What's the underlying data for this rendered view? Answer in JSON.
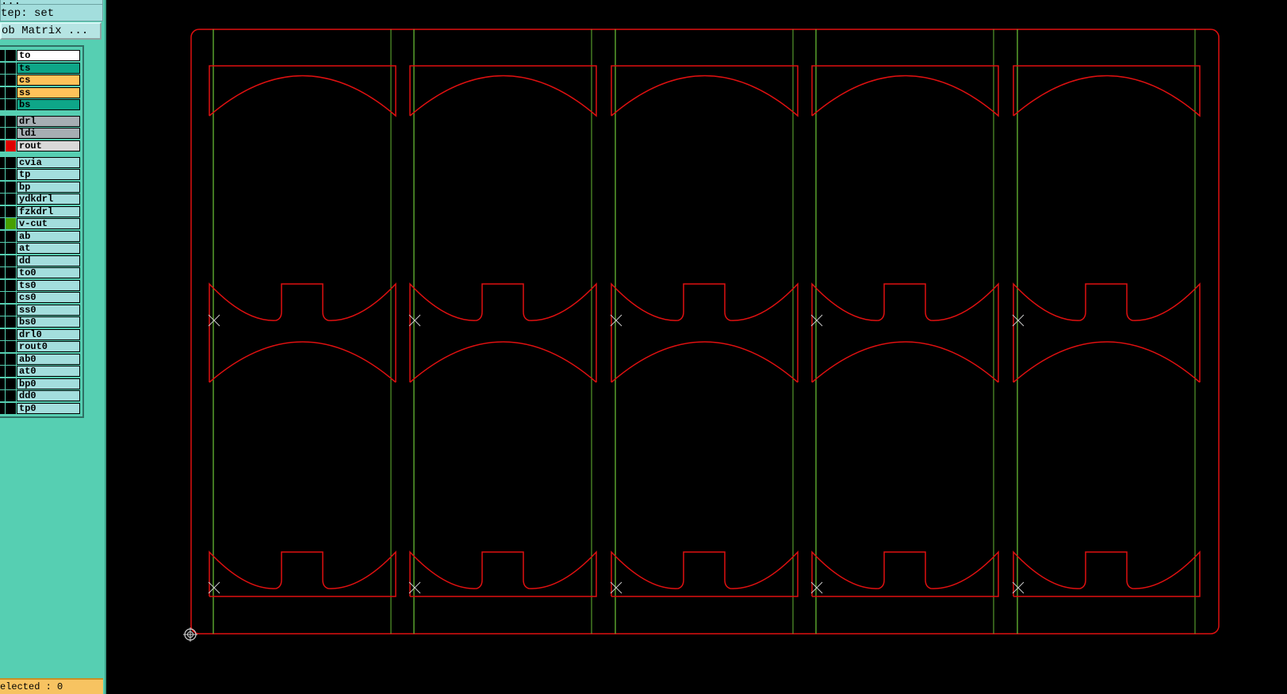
{
  "sidebar": {
    "title_partial": "...",
    "step_label": "tep: set",
    "job_matrix_button": "ob Matrix ..."
  },
  "layers": [
    {
      "name": "to",
      "bg": "#ffffff",
      "mark": ""
    },
    {
      "name": "ts",
      "bg": "#0ea688",
      "mark": ""
    },
    {
      "name": "cs",
      "bg": "#ffc25a",
      "mark": ""
    },
    {
      "name": "ss",
      "bg": "#ffc25a",
      "mark": ""
    },
    {
      "name": "bs",
      "bg": "#0ea688",
      "mark": ""
    },
    {
      "name": "drl",
      "bg": "#a6aeb3",
      "mark": ""
    },
    {
      "name": "ldi",
      "bg": "#a6aeb3",
      "mark": ""
    },
    {
      "name": "rout",
      "bg": "#d9d9d9",
      "mark": "#e00000"
    },
    {
      "name": "cvia",
      "bg": "#a3dedd",
      "mark": ""
    },
    {
      "name": "tp",
      "bg": "#a3dedd",
      "mark": ""
    },
    {
      "name": "bp",
      "bg": "#a3dedd",
      "mark": ""
    },
    {
      "name": "ydkdrl",
      "bg": "#a3dedd",
      "mark": ""
    },
    {
      "name": "fzkdrl",
      "bg": "#a3dedd",
      "mark": ""
    },
    {
      "name": "v-cut",
      "bg": "#a3dedd",
      "mark": "#47a000"
    },
    {
      "name": "ab",
      "bg": "#a3dedd",
      "mark": ""
    },
    {
      "name": "at",
      "bg": "#a3dedd",
      "mark": ""
    },
    {
      "name": "dd",
      "bg": "#a3dedd",
      "mark": ""
    },
    {
      "name": "to0",
      "bg": "#a3dedd",
      "mark": ""
    },
    {
      "name": "ts0",
      "bg": "#a3dedd",
      "mark": ""
    },
    {
      "name": "cs0",
      "bg": "#a3dedd",
      "mark": ""
    },
    {
      "name": "ss0",
      "bg": "#a3dedd",
      "mark": ""
    },
    {
      "name": "bs0",
      "bg": "#a3dedd",
      "mark": ""
    },
    {
      "name": "drl0",
      "bg": "#a3dedd",
      "mark": ""
    },
    {
      "name": "rout0",
      "bg": "#a3dedd",
      "mark": ""
    },
    {
      "name": "ab0",
      "bg": "#a3dedd",
      "mark": ""
    },
    {
      "name": "at0",
      "bg": "#a3dedd",
      "mark": ""
    },
    {
      "name": "bp0",
      "bg": "#a3dedd",
      "mark": ""
    },
    {
      "name": "dd0",
      "bg": "#a3dedd",
      "mark": ""
    },
    {
      "name": "tp0",
      "bg": "#a3dedd",
      "mark": ""
    }
  ],
  "status": {
    "selected_text": "elected : 0"
  },
  "colors": {
    "canvas_bg": "#000000",
    "rout_line": "#e01010",
    "vcut_line": "#66b833",
    "marker": "#cccccc"
  }
}
